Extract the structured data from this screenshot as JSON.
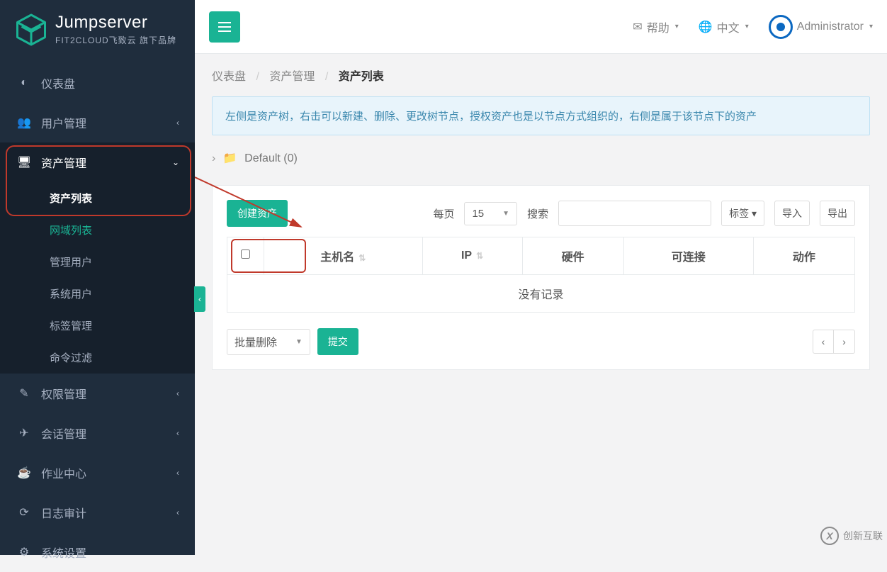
{
  "brand": {
    "title": "Jumpserver",
    "subtitle": "FIT2CLOUD飞致云 旗下品牌"
  },
  "topbar": {
    "help": "帮助",
    "lang": "中文",
    "user": "Administrator"
  },
  "sidebar": {
    "dashboard": "仪表盘",
    "users": "用户管理",
    "assets": "资产管理",
    "assets_children": {
      "asset_list": "资产列表",
      "domain_list": "网域列表",
      "admin_users": "管理用户",
      "system_users": "系统用户",
      "labels": "标签管理",
      "cmd_filter": "命令过滤"
    },
    "perms": "权限管理",
    "sessions": "会话管理",
    "ops": "作业中心",
    "audits": "日志审计",
    "settings": "系统设置"
  },
  "breadcrumb": {
    "a": "仪表盘",
    "b": "资产管理",
    "c": "资产列表"
  },
  "info_text": "左侧是资产树，右击可以新建、删除、更改树节点，授权资产也是以节点方式组织的，右侧是属于该节点下的资产",
  "tree": {
    "root": "Default (0)"
  },
  "toolbar": {
    "create": "创建资产",
    "per_page_label": "每页",
    "per_page_value": "15",
    "search_label": "搜索",
    "tags": "标签",
    "import": "导入",
    "export": "导出"
  },
  "table": {
    "col_host": "主机名",
    "col_ip": "IP",
    "col_hw": "硬件",
    "col_conn": "可连接",
    "col_action": "动作",
    "empty": "没有记录"
  },
  "footer": {
    "batch": "批量删除",
    "submit": "提交"
  },
  "watermark": "创新互联"
}
